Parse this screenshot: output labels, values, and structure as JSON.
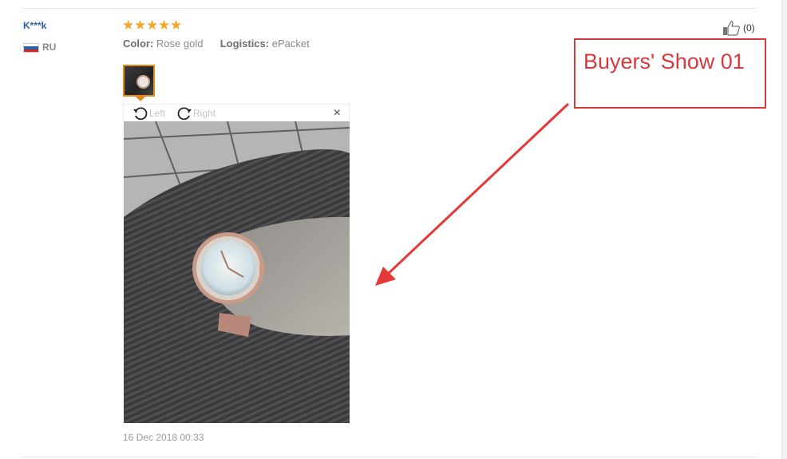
{
  "review": {
    "buyer_name": "K***k",
    "country_code": "RU",
    "rating": 5,
    "attributes": [
      {
        "key": "Color:",
        "value": "Rose gold"
      },
      {
        "key": "Logistics:",
        "value": "ePacket"
      }
    ],
    "date": "16 Dec 2018 00:33",
    "likes": "(0)"
  },
  "viewer": {
    "rotate_left_label": "Left",
    "rotate_right_label": "Right",
    "close_symbol": "×"
  },
  "annotation": {
    "text": "Buyers' Show 01",
    "color": "#d6393d"
  },
  "icons": {
    "star": "star-icon",
    "like": "thumbs-up-icon",
    "rotate_left": "rotate-left-icon",
    "rotate_right": "rotate-right-icon",
    "close": "close-icon",
    "flag": "russia-flag-icon"
  },
  "colors": {
    "buyer_name": "#2b5fa8",
    "star": "#f5a623",
    "thumb_border": "#e48a1c"
  }
}
